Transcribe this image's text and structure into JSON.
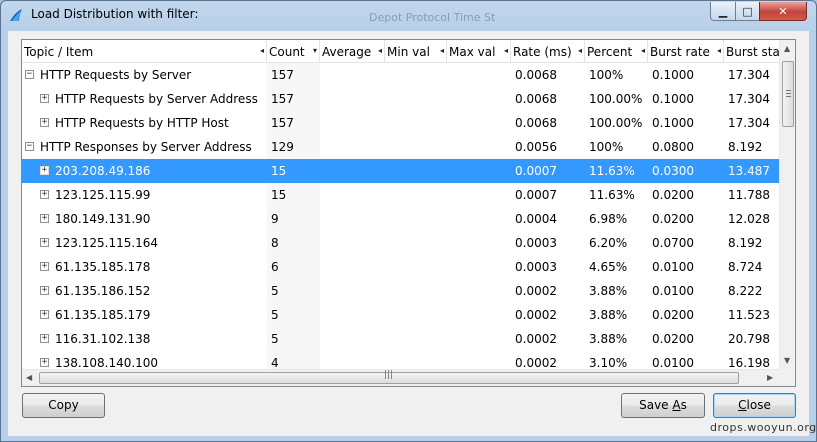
{
  "window": {
    "title": "Load Distribution with filter:",
    "background_ghost_text": "Depot    Protocol  Time St"
  },
  "columns": [
    {
      "label": "Topic / Item",
      "indicator": "◂"
    },
    {
      "label": "Count",
      "indicator": "▾"
    },
    {
      "label": "Average",
      "indicator": "◂"
    },
    {
      "label": "Min val",
      "indicator": "◂"
    },
    {
      "label": "Max val",
      "indicator": "◂"
    },
    {
      "label": "Rate (ms)",
      "indicator": "◂"
    },
    {
      "label": "Percent",
      "indicator": "◂"
    },
    {
      "label": "Burst rate",
      "indicator": "◂"
    },
    {
      "label": "Burst start",
      "indicator": ""
    }
  ],
  "rows": [
    {
      "topic": "HTTP Requests by Server",
      "level": 0,
      "expander": "−",
      "count": "157",
      "average": "",
      "min": "",
      "max": "",
      "rate": "0.0068",
      "percent": "100%",
      "burst_rate": "0.1000",
      "burst_start": "17.304"
    },
    {
      "topic": "HTTP Requests by Server Address",
      "level": 1,
      "expander": "+",
      "count": "157",
      "average": "",
      "min": "",
      "max": "",
      "rate": "0.0068",
      "percent": "100.00%",
      "burst_rate": "0.1000",
      "burst_start": "17.304"
    },
    {
      "topic": "HTTP Requests by HTTP Host",
      "level": 1,
      "expander": "+",
      "count": "157",
      "average": "",
      "min": "",
      "max": "",
      "rate": "0.0068",
      "percent": "100.00%",
      "burst_rate": "0.1000",
      "burst_start": "17.304"
    },
    {
      "topic": "HTTP Responses by Server Address",
      "level": 0,
      "expander": "−",
      "count": "129",
      "average": "",
      "min": "",
      "max": "",
      "rate": "0.0056",
      "percent": "100%",
      "burst_rate": "0.0800",
      "burst_start": "8.192"
    },
    {
      "topic": "203.208.49.186",
      "level": 1,
      "expander": "+",
      "count": "15",
      "average": "",
      "min": "",
      "max": "",
      "rate": "0.0007",
      "percent": "11.63%",
      "burst_rate": "0.0300",
      "burst_start": "13.487",
      "selected": true
    },
    {
      "topic": "123.125.115.99",
      "level": 1,
      "expander": "+",
      "count": "15",
      "average": "",
      "min": "",
      "max": "",
      "rate": "0.0007",
      "percent": "11.63%",
      "burst_rate": "0.0200",
      "burst_start": "11.788"
    },
    {
      "topic": "180.149.131.90",
      "level": 1,
      "expander": "+",
      "count": "9",
      "average": "",
      "min": "",
      "max": "",
      "rate": "0.0004",
      "percent": "6.98%",
      "burst_rate": "0.0200",
      "burst_start": "12.028"
    },
    {
      "topic": "123.125.115.164",
      "level": 1,
      "expander": "+",
      "count": "8",
      "average": "",
      "min": "",
      "max": "",
      "rate": "0.0003",
      "percent": "6.20%",
      "burst_rate": "0.0700",
      "burst_start": "8.192"
    },
    {
      "topic": "61.135.185.178",
      "level": 1,
      "expander": "+",
      "count": "6",
      "average": "",
      "min": "",
      "max": "",
      "rate": "0.0003",
      "percent": "4.65%",
      "burst_rate": "0.0100",
      "burst_start": "8.724"
    },
    {
      "topic": "61.135.186.152",
      "level": 1,
      "expander": "+",
      "count": "5",
      "average": "",
      "min": "",
      "max": "",
      "rate": "0.0002",
      "percent": "3.88%",
      "burst_rate": "0.0100",
      "burst_start": "8.222"
    },
    {
      "topic": "61.135.185.179",
      "level": 1,
      "expander": "+",
      "count": "5",
      "average": "",
      "min": "",
      "max": "",
      "rate": "0.0002",
      "percent": "3.88%",
      "burst_rate": "0.0200",
      "burst_start": "11.523"
    },
    {
      "topic": "116.31.102.138",
      "level": 1,
      "expander": "+",
      "count": "5",
      "average": "",
      "min": "",
      "max": "",
      "rate": "0.0002",
      "percent": "3.88%",
      "burst_rate": "0.0200",
      "burst_start": "20.798"
    },
    {
      "topic": "138.108.140.100",
      "level": 1,
      "expander": "+",
      "count": "4",
      "average": "",
      "min": "",
      "max": "",
      "rate": "0.0002",
      "percent": "3.10%",
      "burst_rate": "0.0100",
      "burst_start": "16.198"
    }
  ],
  "buttons": {
    "copy": "Copy",
    "save_as_prefix": "Save ",
    "save_as_mnemonic": "A",
    "save_as_suffix": "s",
    "close_mnemonic": "C",
    "close_suffix": "lose"
  },
  "watermark": "drops.wooyun.org",
  "colors": {
    "selection": "#3399ff",
    "window_frame": "#b7cfe8"
  }
}
